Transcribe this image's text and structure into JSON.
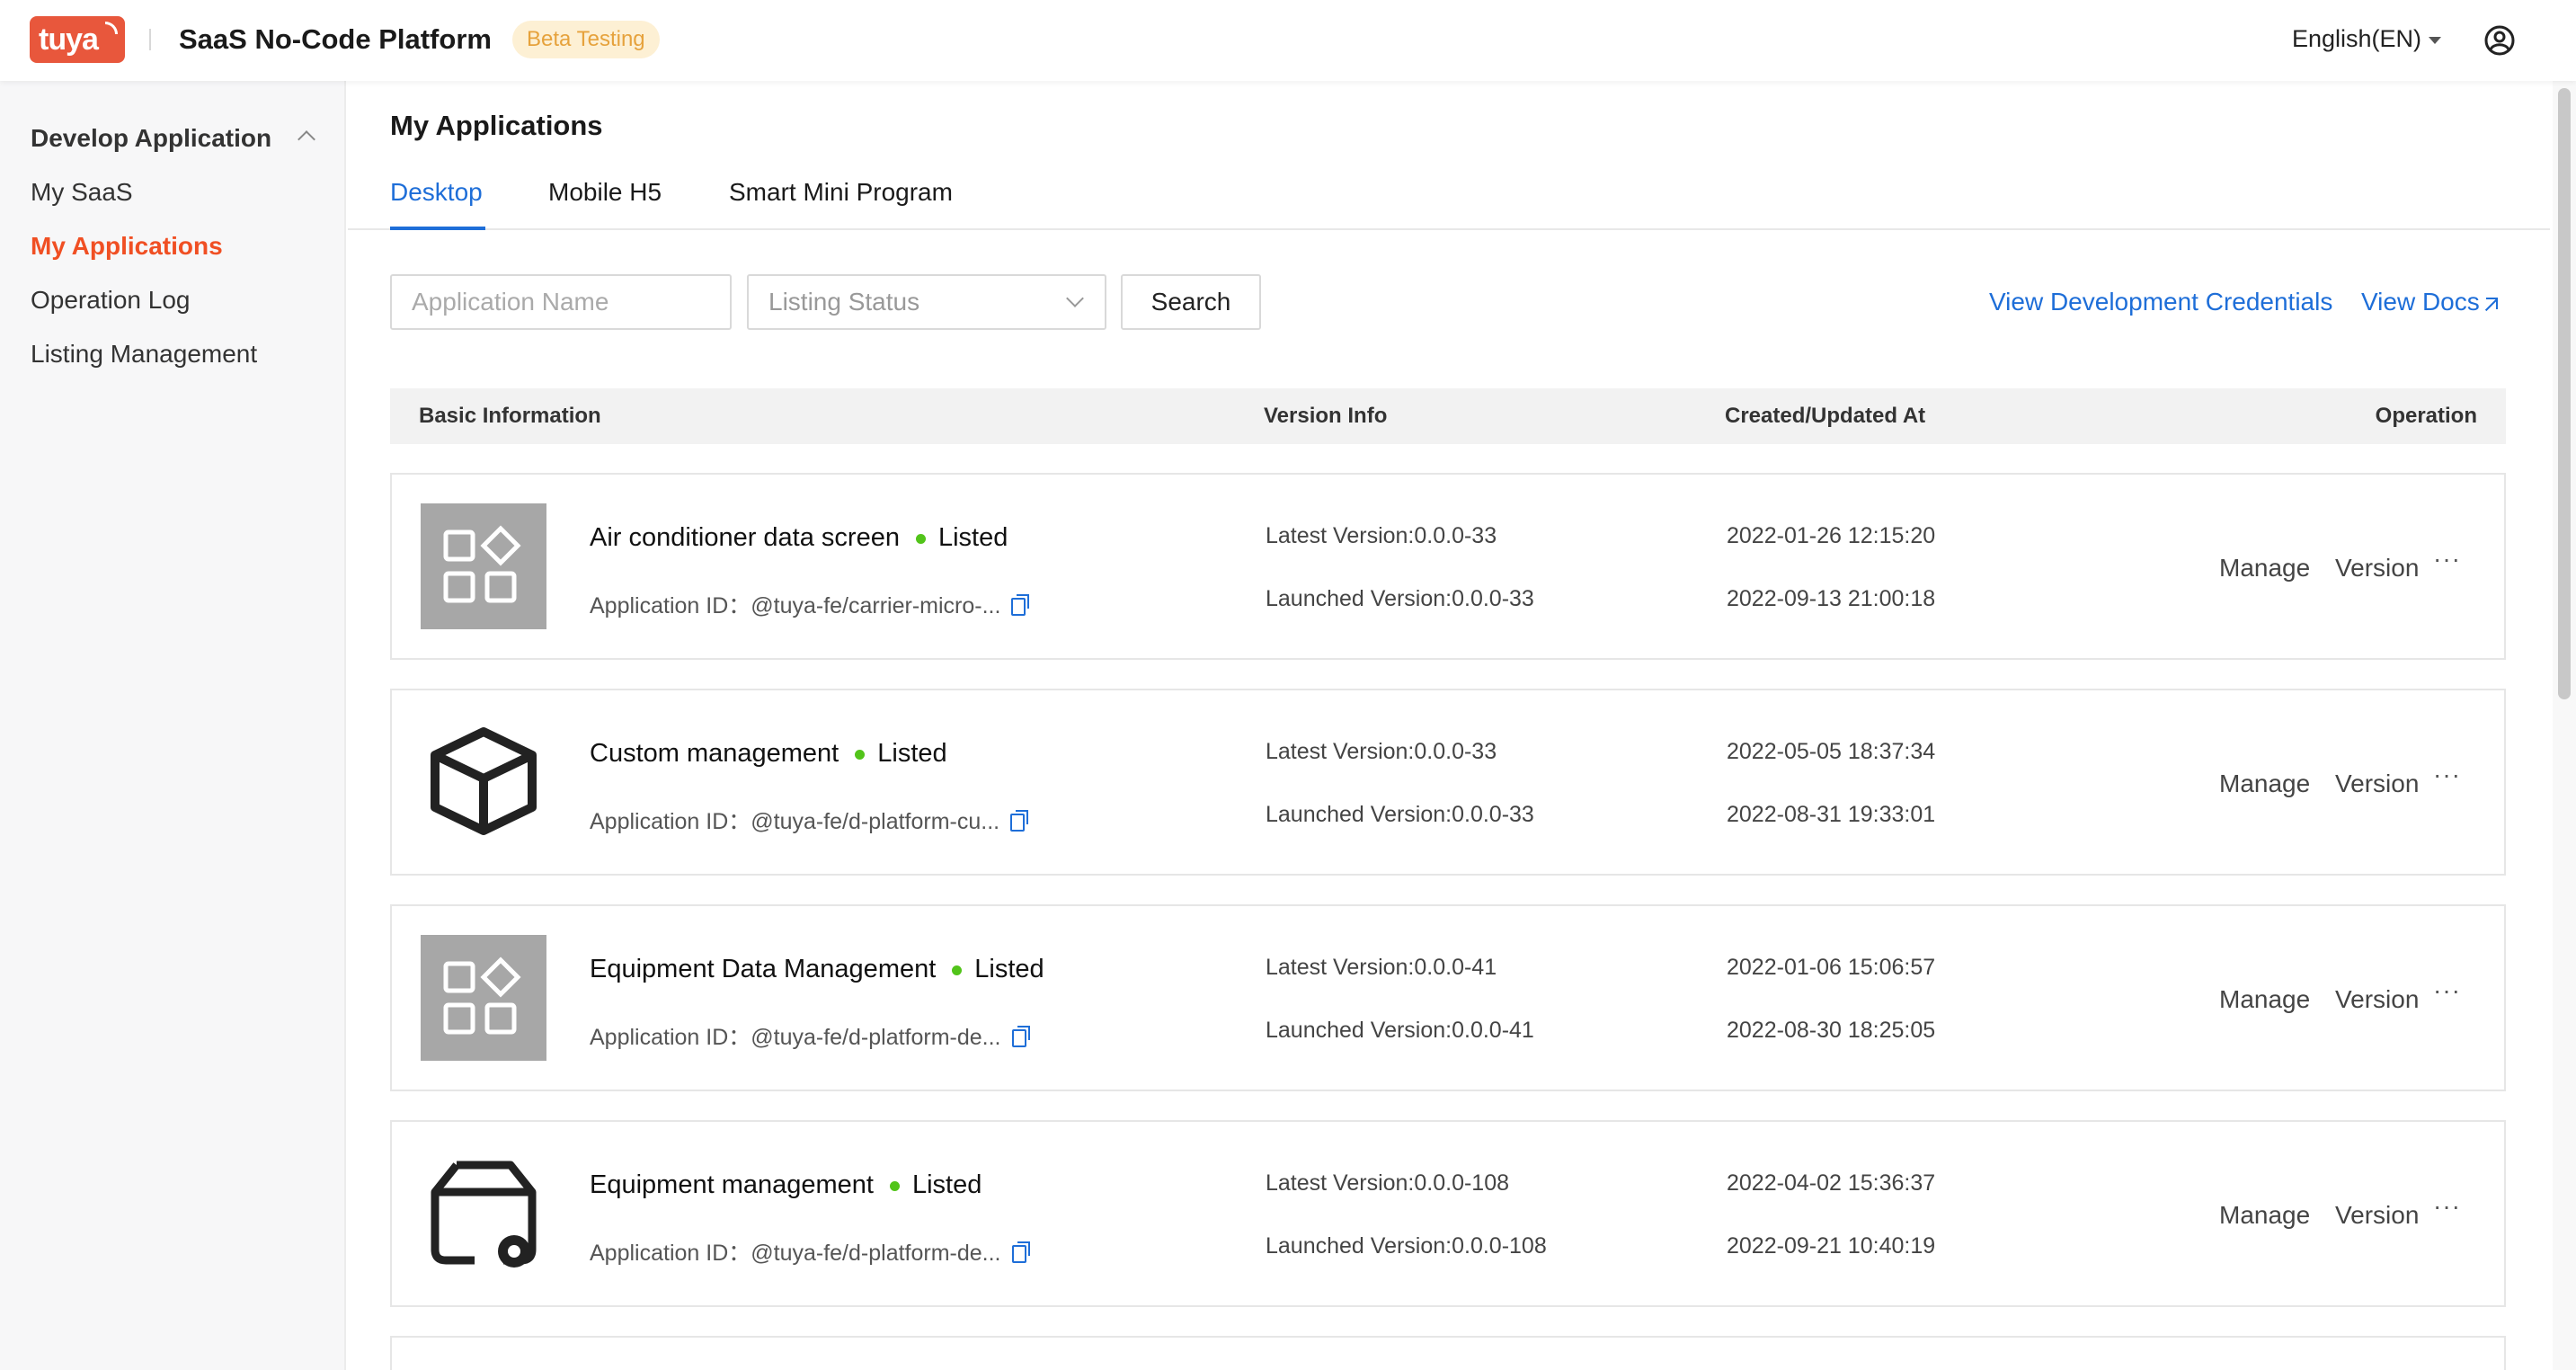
{
  "header": {
    "logo_text": "tuya",
    "app_title": "SaaS No-Code Platform",
    "beta_badge": "Beta Testing",
    "language": "English(EN)",
    "brand_color": "#e8573c"
  },
  "sidebar": {
    "group_label": "Develop Application",
    "items": [
      {
        "label": "My SaaS"
      },
      {
        "label": "My Applications"
      },
      {
        "label": "Operation Log"
      },
      {
        "label": "Listing Management"
      }
    ]
  },
  "main": {
    "page_title": "My Applications",
    "tabs": [
      {
        "label": "Desktop"
      },
      {
        "label": "Mobile H5"
      },
      {
        "label": "Smart Mini Program"
      }
    ],
    "filters": {
      "app_name_placeholder": "Application Name",
      "listing_status_placeholder": "Listing Status",
      "search_label": "Search"
    },
    "links": {
      "credentials": "View Development Credentials",
      "docs": "View Docs"
    },
    "table": {
      "headers": {
        "basic": "Basic Information",
        "version": "Version Info",
        "dates": "Created/Updated At",
        "operation": "Operation"
      },
      "rows": [
        {
          "name": "Air conditioner data screen",
          "status": "Listed",
          "app_id": "Application ID：@tuya-fe/carrier-micro-...",
          "latest": "Latest Version:0.0.0-33",
          "launched": "Launched Version:0.0.0-33",
          "created": "2022-01-26 12:15:20",
          "updated": "2022-09-13 21:00:18",
          "manage": "Manage",
          "version": "Version",
          "more": "···"
        },
        {
          "name": "Custom management",
          "status": "Listed",
          "app_id": "Application ID：@tuya-fe/d-platform-cu...",
          "latest": "Latest Version:0.0.0-33",
          "launched": "Launched Version:0.0.0-33",
          "created": "2022-05-05 18:37:34",
          "updated": "2022-08-31 19:33:01",
          "manage": "Manage",
          "version": "Version",
          "more": "···"
        },
        {
          "name": "Equipment Data Management",
          "status": "Listed",
          "app_id": "Application ID：@tuya-fe/d-platform-de...",
          "latest": "Latest Version:0.0.0-41",
          "launched": "Launched Version:0.0.0-41",
          "created": "2022-01-06 15:06:57",
          "updated": "2022-08-30 18:25:05",
          "manage": "Manage",
          "version": "Version",
          "more": "···"
        },
        {
          "name": "Equipment management",
          "status": "Listed",
          "app_id": "Application ID：@tuya-fe/d-platform-de...",
          "latest": "Latest Version:0.0.0-108",
          "launched": "Launched Version:0.0.0-108",
          "created": "2022-04-02 15:36:37",
          "updated": "2022-09-21 10:40:19",
          "manage": "Manage",
          "version": "Version",
          "more": "···"
        }
      ]
    }
  },
  "icons": {
    "row_icons": [
      "apps-grid-icon",
      "cube-icon",
      "apps-grid-icon",
      "device-settings-icon"
    ]
  }
}
